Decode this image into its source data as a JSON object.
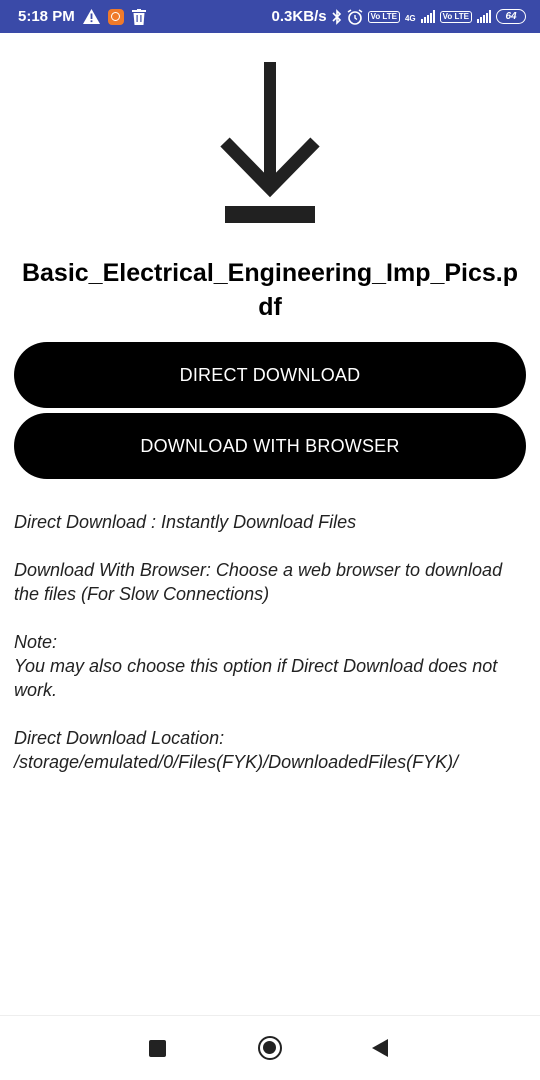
{
  "status_bar": {
    "time": "5:18 PM",
    "net_speed": "0.3KB/s",
    "volte_label": "Vo LTE",
    "network_label": "4G",
    "battery": "64",
    "icons": [
      "warning-icon",
      "app-notification-icon",
      "trash-icon",
      "bluetooth-icon",
      "alarm-icon",
      "volte-icon",
      "signal-icon",
      "battery-icon"
    ]
  },
  "download": {
    "icon": "download-arrow-icon",
    "file_name": "Basic_Electrical_Engineering_Imp_Pics.pdf"
  },
  "buttons": {
    "direct": "DIRECT DOWNLOAD",
    "browser": "DOWNLOAD WITH BROWSER"
  },
  "info": {
    "direct_desc": "Direct Download : Instantly Download Files",
    "browser_desc": "Download With Browser: Choose a web browser to download the files (For Slow Connections)",
    "note_title": "Note:",
    "note_body": "You may also choose this option if Direct Download does not work.",
    "location_title": "Direct Download Location:",
    "location_path": "/storage/emulated/0/Files(FYK)/DownloadedFiles(FYK)/"
  },
  "nav": {
    "icons": [
      "recents-icon",
      "home-icon",
      "back-icon"
    ]
  },
  "colors": {
    "status_bar": "#3a4aa8",
    "button_bg": "#000000",
    "button_text": "#ffffff"
  }
}
